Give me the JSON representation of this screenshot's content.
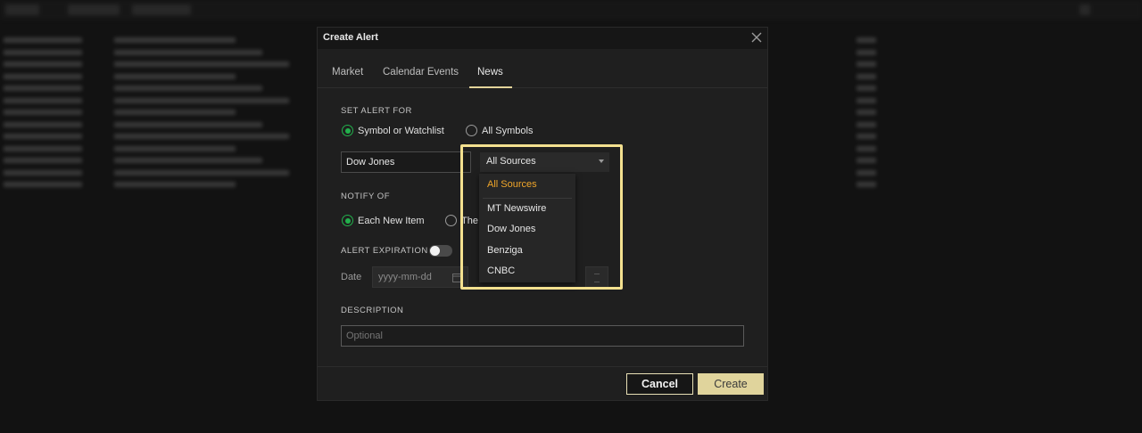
{
  "dialog": {
    "title": "Create Alert",
    "tabs": [
      {
        "label": "Market"
      },
      {
        "label": "Calendar Events"
      },
      {
        "label": "News",
        "active": true
      }
    ]
  },
  "set_alert_for": {
    "label": "SET ALERT FOR",
    "options": [
      {
        "label": "Symbol or Watchlist",
        "selected": true
      },
      {
        "label": "All Symbols",
        "selected": false
      }
    ],
    "symbol_value": "Dow Jones"
  },
  "source_select": {
    "value": "All Sources",
    "options": [
      "All Sources",
      "MT Newswire",
      "Dow Jones",
      "Benziga",
      "CNBC"
    ],
    "selected_option": "All Sources"
  },
  "notify_of": {
    "label": "NOTIFY OF",
    "options": [
      {
        "label": "Each New Item",
        "selected": true
      },
      {
        "label": "The",
        "selected": false
      }
    ]
  },
  "alert_expiration": {
    "label": "ALERT EXPIRATION",
    "enabled": false,
    "date_label": "Date",
    "date_placeholder": "yyyy-mm-dd"
  },
  "description": {
    "label": "DESCRIPTION",
    "placeholder": "Optional"
  },
  "buttons": {
    "cancel": "Cancel",
    "create": "Create"
  },
  "colors": {
    "accent": "#e0d49c",
    "highlight_border": "#f3e08f",
    "radio_on": "#22b14c",
    "selected_option": "#f0a62a"
  }
}
